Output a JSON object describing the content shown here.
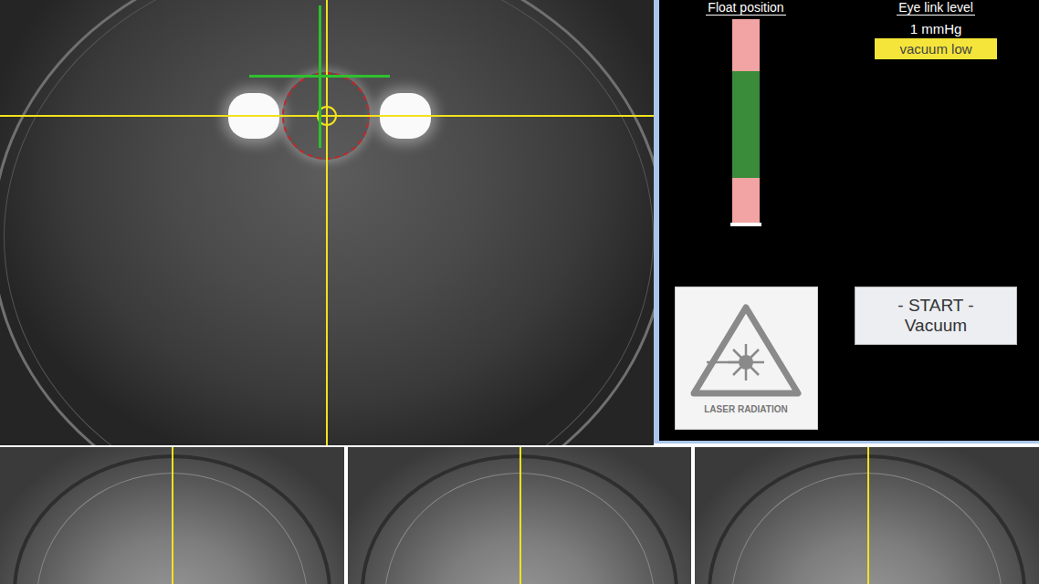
{
  "float_gauge": {
    "label": "Float position",
    "level": 0.01
  },
  "eye_link": {
    "label": "Eye link level",
    "reading": "1 mmHg",
    "warning": "vacuum low"
  },
  "laser_warning": {
    "label": "LASER RADIATION"
  },
  "start_button": {
    "lines": [
      "- START -",
      "Vacuum"
    ]
  }
}
